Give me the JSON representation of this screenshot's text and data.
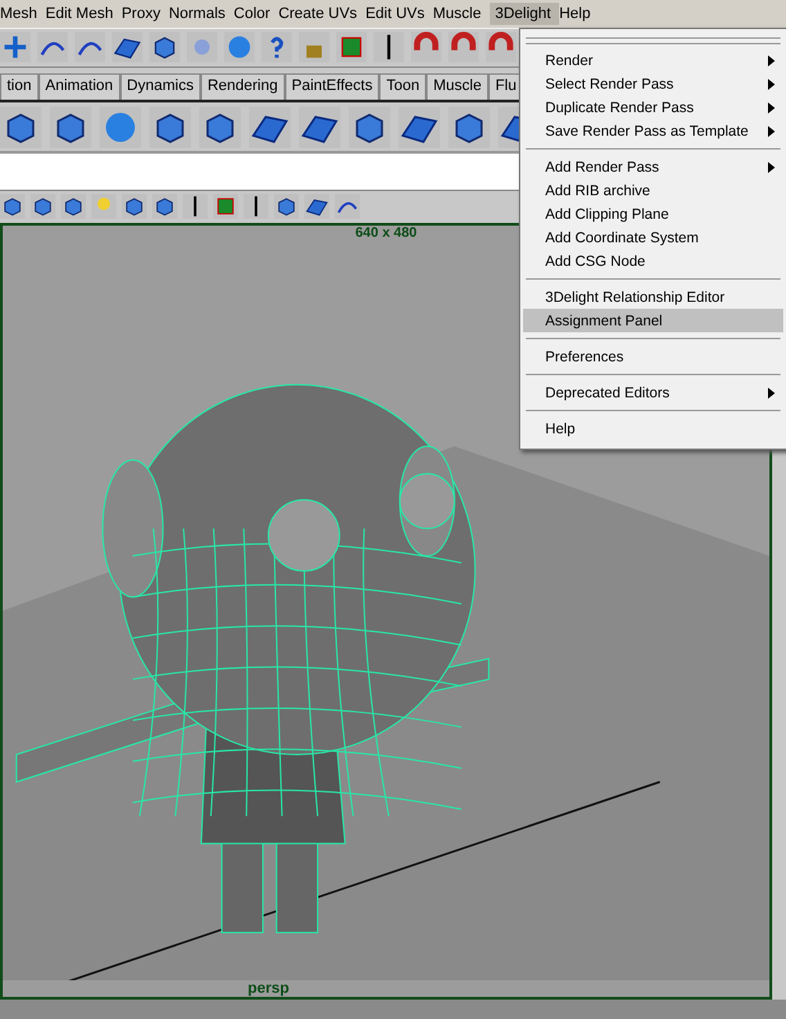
{
  "menu_bar": [
    {
      "label": "Mesh",
      "selected": false
    },
    {
      "label": "Edit Mesh",
      "selected": false
    },
    {
      "label": "Proxy",
      "selected": false
    },
    {
      "label": "Normals",
      "selected": false
    },
    {
      "label": "Color",
      "selected": false
    },
    {
      "label": "Create UVs",
      "selected": false
    },
    {
      "label": "Edit UVs",
      "selected": false
    },
    {
      "label": "Muscle",
      "selected": false
    },
    {
      "label": "3Delight",
      "selected": true
    },
    {
      "label": "Help",
      "selected": false
    }
  ],
  "shelf_tabs": [
    {
      "label": "tion"
    },
    {
      "label": "Animation"
    },
    {
      "label": "Dynamics"
    },
    {
      "label": "Rendering"
    },
    {
      "label": "PaintEffects"
    },
    {
      "label": "Toon"
    },
    {
      "label": "Muscle"
    },
    {
      "label": "Flu"
    }
  ],
  "viewport": {
    "resolution": "640 x 480",
    "camera": "persp"
  },
  "dropdown_menu": [
    {
      "kind": "item",
      "label": "Render",
      "submenu": true,
      "selected": false
    },
    {
      "kind": "item",
      "label": "Select Render Pass",
      "submenu": true,
      "selected": false
    },
    {
      "kind": "item",
      "label": "Duplicate Render Pass",
      "submenu": true,
      "selected": false
    },
    {
      "kind": "item",
      "label": "Save Render Pass as Template",
      "submenu": true,
      "selected": false
    },
    {
      "kind": "separator"
    },
    {
      "kind": "item",
      "label": "Add Render Pass",
      "submenu": true,
      "selected": false
    },
    {
      "kind": "item",
      "label": "Add RIB archive",
      "submenu": false,
      "selected": false
    },
    {
      "kind": "item",
      "label": "Add Clipping Plane",
      "submenu": false,
      "selected": false
    },
    {
      "kind": "item",
      "label": "Add Coordinate System",
      "submenu": false,
      "selected": false
    },
    {
      "kind": "item",
      "label": "Add CSG Node",
      "submenu": false,
      "selected": false
    },
    {
      "kind": "separator"
    },
    {
      "kind": "item",
      "label": "3Delight Relationship Editor",
      "submenu": false,
      "selected": false
    },
    {
      "kind": "item",
      "label": "Assignment Panel",
      "submenu": false,
      "selected": true
    },
    {
      "kind": "separator"
    },
    {
      "kind": "item",
      "label": "Preferences",
      "submenu": false,
      "selected": false
    },
    {
      "kind": "separator"
    },
    {
      "kind": "item",
      "label": "Deprecated Editors",
      "submenu": true,
      "selected": false
    },
    {
      "kind": "separator"
    },
    {
      "kind": "item",
      "label": "Help",
      "submenu": false,
      "selected": false
    }
  ]
}
